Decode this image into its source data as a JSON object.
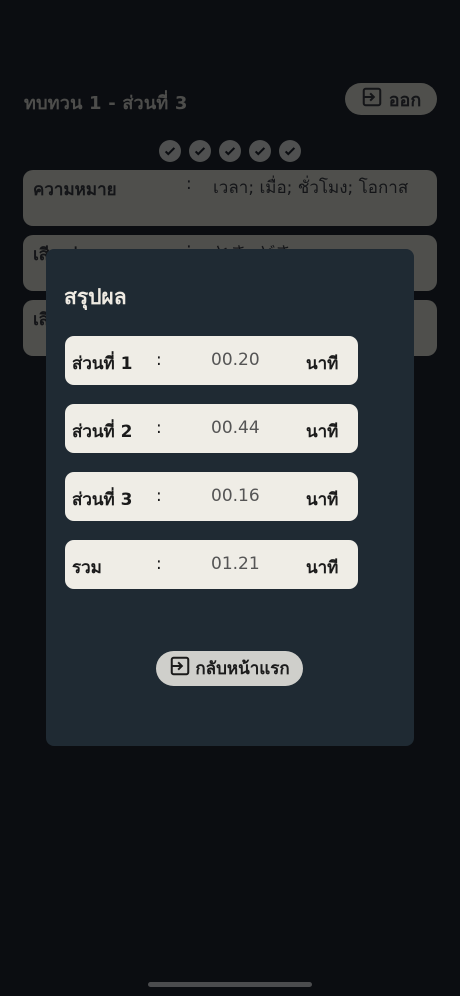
{
  "header": {
    "title": "ทบทวน 1 - ส่วนที่ 3",
    "exit_label": "ออก"
  },
  "progress": {
    "completed": 5,
    "total": 5
  },
  "cards": [
    {
      "label": "ความหมาย",
      "separator": ":",
      "value": "เวลา; เมื่อ; ชั่วโมง; โอกาส"
    },
    {
      "label": "เสียงอ่าน",
      "separator": ":",
      "value": "とき; どき"
    },
    {
      "label": "เสียงอ่าน",
      "separator": ":",
      "value": ""
    }
  ],
  "modal": {
    "title": "สรุปผล",
    "rows": [
      {
        "label": "ส่วนที่ 1",
        "separator": ":",
        "time": "00.20",
        "unit": "นาที"
      },
      {
        "label": "ส่วนที่ 2",
        "separator": ":",
        "time": "00.44",
        "unit": "นาที"
      },
      {
        "label": "ส่วนที่ 3",
        "separator": ":",
        "time": "00.16",
        "unit": "นาที"
      },
      {
        "label": "รวม",
        "separator": ":",
        "time": "01.21",
        "unit": "นาที"
      }
    ],
    "home_label": "กลับหน้าแรก"
  },
  "icons": {
    "exit": "exit-icon",
    "check": "check-circle-icon",
    "home": "exit-icon"
  },
  "colors": {
    "modal_bg": "#1f2a33",
    "row_bg": "#efede6",
    "page_bg": "#0b0d11"
  }
}
